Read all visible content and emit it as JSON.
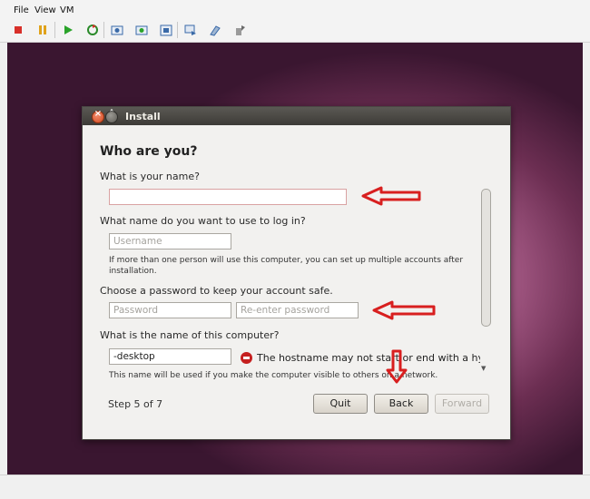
{
  "menu": {
    "file": "File",
    "view": "View",
    "vm": "VM"
  },
  "toolbar_icons": [
    "stop-icon",
    "pause-icon",
    "play-icon",
    "reset-icon",
    "snapshot-icon",
    "snapshot-restore-icon",
    "snapshot-manager-icon",
    "devices-icon",
    "settings-icon",
    "usb-icon"
  ],
  "window": {
    "title": "Install"
  },
  "form": {
    "heading": "Who are you?",
    "name_label": "What is your name?",
    "name_value": "",
    "login_label": "What name do you want to use to log in?",
    "username_placeholder": "Username",
    "login_note_1": "If more than one person will use this computer, you can set up multiple accounts after",
    "login_note_2": "installation.",
    "password_label": "Choose a password to keep your account safe.",
    "password_placeholder": "Password",
    "reenter_placeholder": "Re-enter password",
    "hostname_label": "What is the name of this computer?",
    "hostname_value": "-desktop",
    "hostname_error": "The hostname may not start or end with a hyphen.",
    "hostname_note": "This name will be used if you make the computer visible to others on a network."
  },
  "footer": {
    "step": "Step 5 of 7",
    "quit": "Quit",
    "back": "Back",
    "forward": "Forward"
  },
  "colors": {
    "annotation_red": "#d81f1f",
    "accent_error": "#c51f1f"
  }
}
